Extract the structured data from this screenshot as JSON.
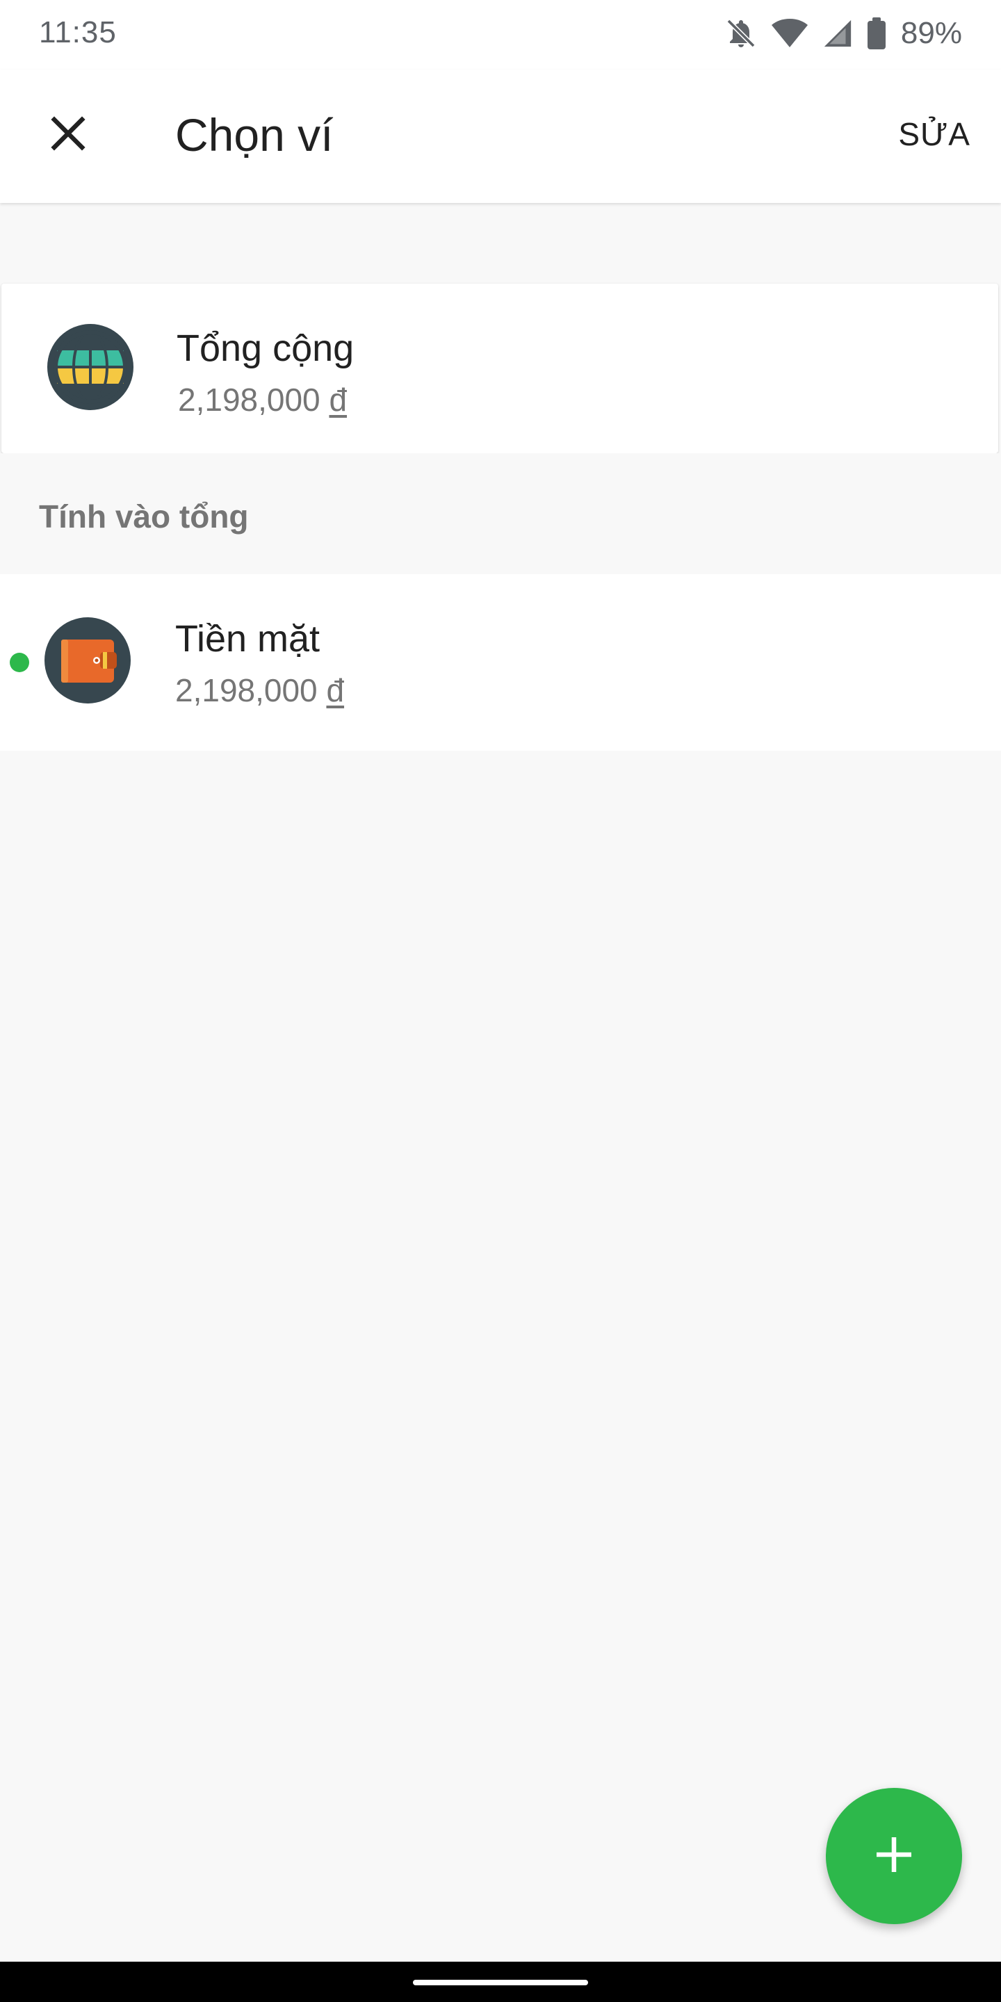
{
  "status_bar": {
    "time": "11:35",
    "battery_percent": "89%",
    "icons": [
      "bell-off-icon",
      "wifi-icon",
      "signal-icon",
      "battery-icon"
    ]
  },
  "app_bar": {
    "title": "Chọn ví",
    "edit_label": "SỬA",
    "close_icon": "close-icon"
  },
  "total": {
    "name": "Tổng cộng",
    "amount": "2,198,000",
    "currency": "đ",
    "icon": "globe-icon"
  },
  "section": {
    "header": "Tính vào tổng"
  },
  "wallets": [
    {
      "name": "Tiền mặt",
      "amount": "2,198,000",
      "currency": "đ",
      "icon": "wallet-icon",
      "active": true
    }
  ],
  "fab": {
    "icon": "plus-icon"
  },
  "colors": {
    "accent": "#2db84b",
    "icon_bg": "#37474f",
    "wallet_orange": "#e8692a",
    "globe_teal": "#3dbda0",
    "globe_yellow": "#f5c842"
  }
}
